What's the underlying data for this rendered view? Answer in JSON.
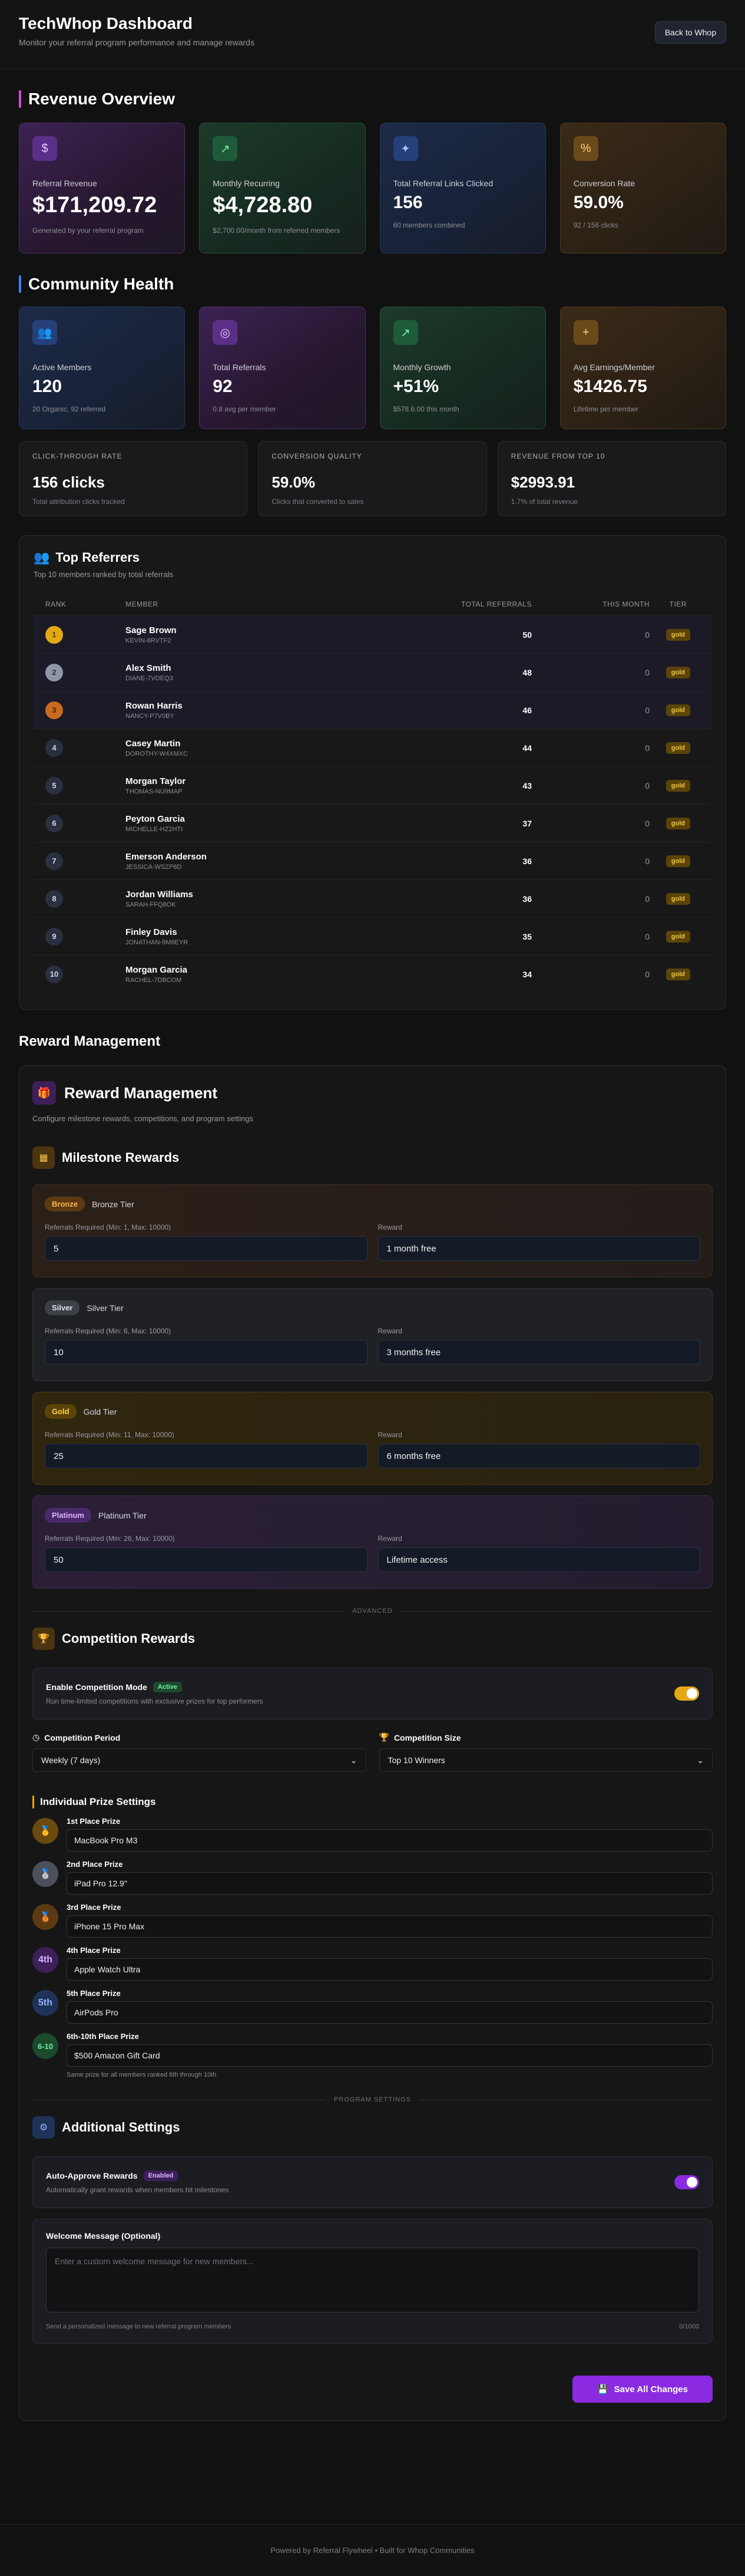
{
  "header": {
    "title": "TechWhop Dashboard",
    "subtitle": "Monitor your referral program performance and manage rewards",
    "back_button": "Back to Whop"
  },
  "revenue": {
    "title": "Revenue Overview",
    "cards": [
      {
        "label": "Referral Revenue",
        "value": "$171,209.72",
        "note": "Generated by your referral program",
        "icon": "dollar-icon"
      },
      {
        "label": "Monthly Recurring",
        "value": "$4,728.80",
        "note": "$2,700.00/month from referred members",
        "icon": "trend-up-icon"
      },
      {
        "label": "Total Referral Links Clicked",
        "value": "156",
        "note": "60 members combined",
        "icon": "sparkle-icon"
      },
      {
        "label": "Conversion Rate",
        "value": "59.0%",
        "note": "92 / 156 clicks",
        "icon": "percent-icon"
      }
    ]
  },
  "community": {
    "title": "Community Health",
    "cards": [
      {
        "label": "Active Members",
        "value": "120",
        "note": "20 Organic, 92 referred",
        "icon": "users-icon"
      },
      {
        "label": "Total Referrals",
        "value": "92",
        "note": "0.8 avg per member",
        "icon": "target-icon"
      },
      {
        "label": "Monthly Growth",
        "value": "+51%",
        "note": "$578.6.00 this month",
        "icon": "trend-up-icon"
      },
      {
        "label": "Avg Earnings/Member",
        "value": "$1426.75",
        "note": "Lifetime per member",
        "icon": "user-plus-icon"
      }
    ],
    "mini": [
      {
        "label": "Click-Through Rate",
        "value": "156 clicks",
        "note": "Total attribution clicks tracked"
      },
      {
        "label": "Conversion Quality",
        "value": "59.0%",
        "note": "Clicks that converted to sales"
      },
      {
        "label": "Revenue From Top 10",
        "value": "$2993.91",
        "note": "1.7% of total revenue"
      }
    ]
  },
  "referrers": {
    "title": "Top Referrers",
    "subtitle": "Top 10 members ranked by total referrals",
    "columns": [
      "Rank",
      "Member",
      "Total Referrals",
      "This Month",
      "Tier"
    ],
    "rows": [
      {
        "rank": "1",
        "name": "Sage Brown",
        "code": "KEVIN-8RVTF2",
        "total": "50",
        "month": "0",
        "tier": "gold"
      },
      {
        "rank": "2",
        "name": "Alex Smith",
        "code": "DIANE-7VDEQ3",
        "total": "48",
        "month": "0",
        "tier": "gold"
      },
      {
        "rank": "3",
        "name": "Rowan Harris",
        "code": "NANCY-P7V0BY",
        "total": "46",
        "month": "0",
        "tier": "gold"
      },
      {
        "rank": "4",
        "name": "Casey Martin",
        "code": "DOROTHY-W4XMXC",
        "total": "44",
        "month": "0",
        "tier": "gold"
      },
      {
        "rank": "5",
        "name": "Morgan Taylor",
        "code": "THOMAS-NU9MAP",
        "total": "43",
        "month": "0",
        "tier": "gold"
      },
      {
        "rank": "6",
        "name": "Peyton Garcia",
        "code": "MICHELLE-HZ2HTI",
        "total": "37",
        "month": "0",
        "tier": "gold"
      },
      {
        "rank": "7",
        "name": "Emerson Anderson",
        "code": "JESSICA-WSZP8D",
        "total": "36",
        "month": "0",
        "tier": "gold"
      },
      {
        "rank": "8",
        "name": "Jordan Williams",
        "code": "SARAH-FFQ8OK",
        "total": "36",
        "month": "0",
        "tier": "gold"
      },
      {
        "rank": "9",
        "name": "Finley Davis",
        "code": "JONATHAN-9M8EYR",
        "total": "35",
        "month": "0",
        "tier": "gold"
      },
      {
        "rank": "10",
        "name": "Morgan Garcia",
        "code": "RACHEL-7DBCOM",
        "total": "34",
        "month": "0",
        "tier": "gold"
      }
    ]
  },
  "reward": {
    "outer_title": "Reward Management",
    "title": "Reward Management",
    "subtitle": "Configure milestone rewards, competitions, and program settings",
    "milestones_title": "Milestone Rewards",
    "tiers": [
      {
        "tag": "Bronze",
        "name": "Bronze Tier",
        "req_label": "Referrals Required (Min: 1, Max: 10000)",
        "req": "5",
        "reward_label": "Reward",
        "reward": "1 month free"
      },
      {
        "tag": "Silver",
        "name": "Silver Tier",
        "req_label": "Referrals Required (Min: 6, Max: 10000)",
        "req": "10",
        "reward_label": "Reward",
        "reward": "3 months free"
      },
      {
        "tag": "Gold",
        "name": "Gold Tier",
        "req_label": "Referrals Required (Min: 11, Max: 10000)",
        "req": "25",
        "reward_label": "Reward",
        "reward": "6 months free"
      },
      {
        "tag": "Platinum",
        "name": "Platinum Tier",
        "req_label": "Referrals Required (Min: 26, Max: 10000)",
        "req": "50",
        "reward_label": "Reward",
        "reward": "Lifetime access"
      }
    ],
    "advanced_divider": "Advanced",
    "competition_title": "Competition Rewards",
    "competition_toggle": {
      "title": "Enable Competition Mode",
      "badge": "Active",
      "sub": "Run time-limited competitions with exclusive prizes for top performers"
    },
    "period_label": "Competition Period",
    "period_value": "Weekly (7 days)",
    "size_label": "Competition Size",
    "size_value": "Top 10 Winners",
    "prize_title": "Individual Prize Settings",
    "prizes": [
      {
        "label": "1st Place Prize",
        "value": "MacBook Pro M3",
        "badge": "🥇"
      },
      {
        "label": "2nd Place Prize",
        "value": "iPad Pro 12.9\"",
        "badge": "🥈"
      },
      {
        "label": "3rd Place Prize",
        "value": "iPhone 15 Pro Max",
        "badge": "🥉"
      },
      {
        "label": "4th Place Prize",
        "value": "Apple Watch Ultra",
        "badge": "4th"
      },
      {
        "label": "5th Place Prize",
        "value": "AirPods Pro",
        "badge": "5th"
      },
      {
        "label": "6th-10th Place Prize",
        "value": "$500 Amazon Gift Card",
        "badge": "6-10"
      }
    ],
    "prize_note": "Same prize for all members ranked 6th through 10th",
    "program_divider": "Program Settings",
    "additional_title": "Additional Settings",
    "auto_toggle": {
      "title": "Auto-Approve Rewards",
      "badge": "Enabled",
      "sub": "Automatically grant rewards when members hit milestones"
    },
    "welcome_label": "Welcome Message (Optional)",
    "welcome_placeholder": "Enter a custom welcome message for new members...",
    "welcome_hint": "Send a personalized message to new referral program members",
    "welcome_count": "0/1000",
    "save_label": "Save All Changes"
  },
  "footer": {
    "text": "Powered by Referral Flywheel • Built for Whop Communities"
  },
  "colors": {
    "accent": "#8a2be2",
    "gold": "#e3a915",
    "green": "#22c55e"
  }
}
